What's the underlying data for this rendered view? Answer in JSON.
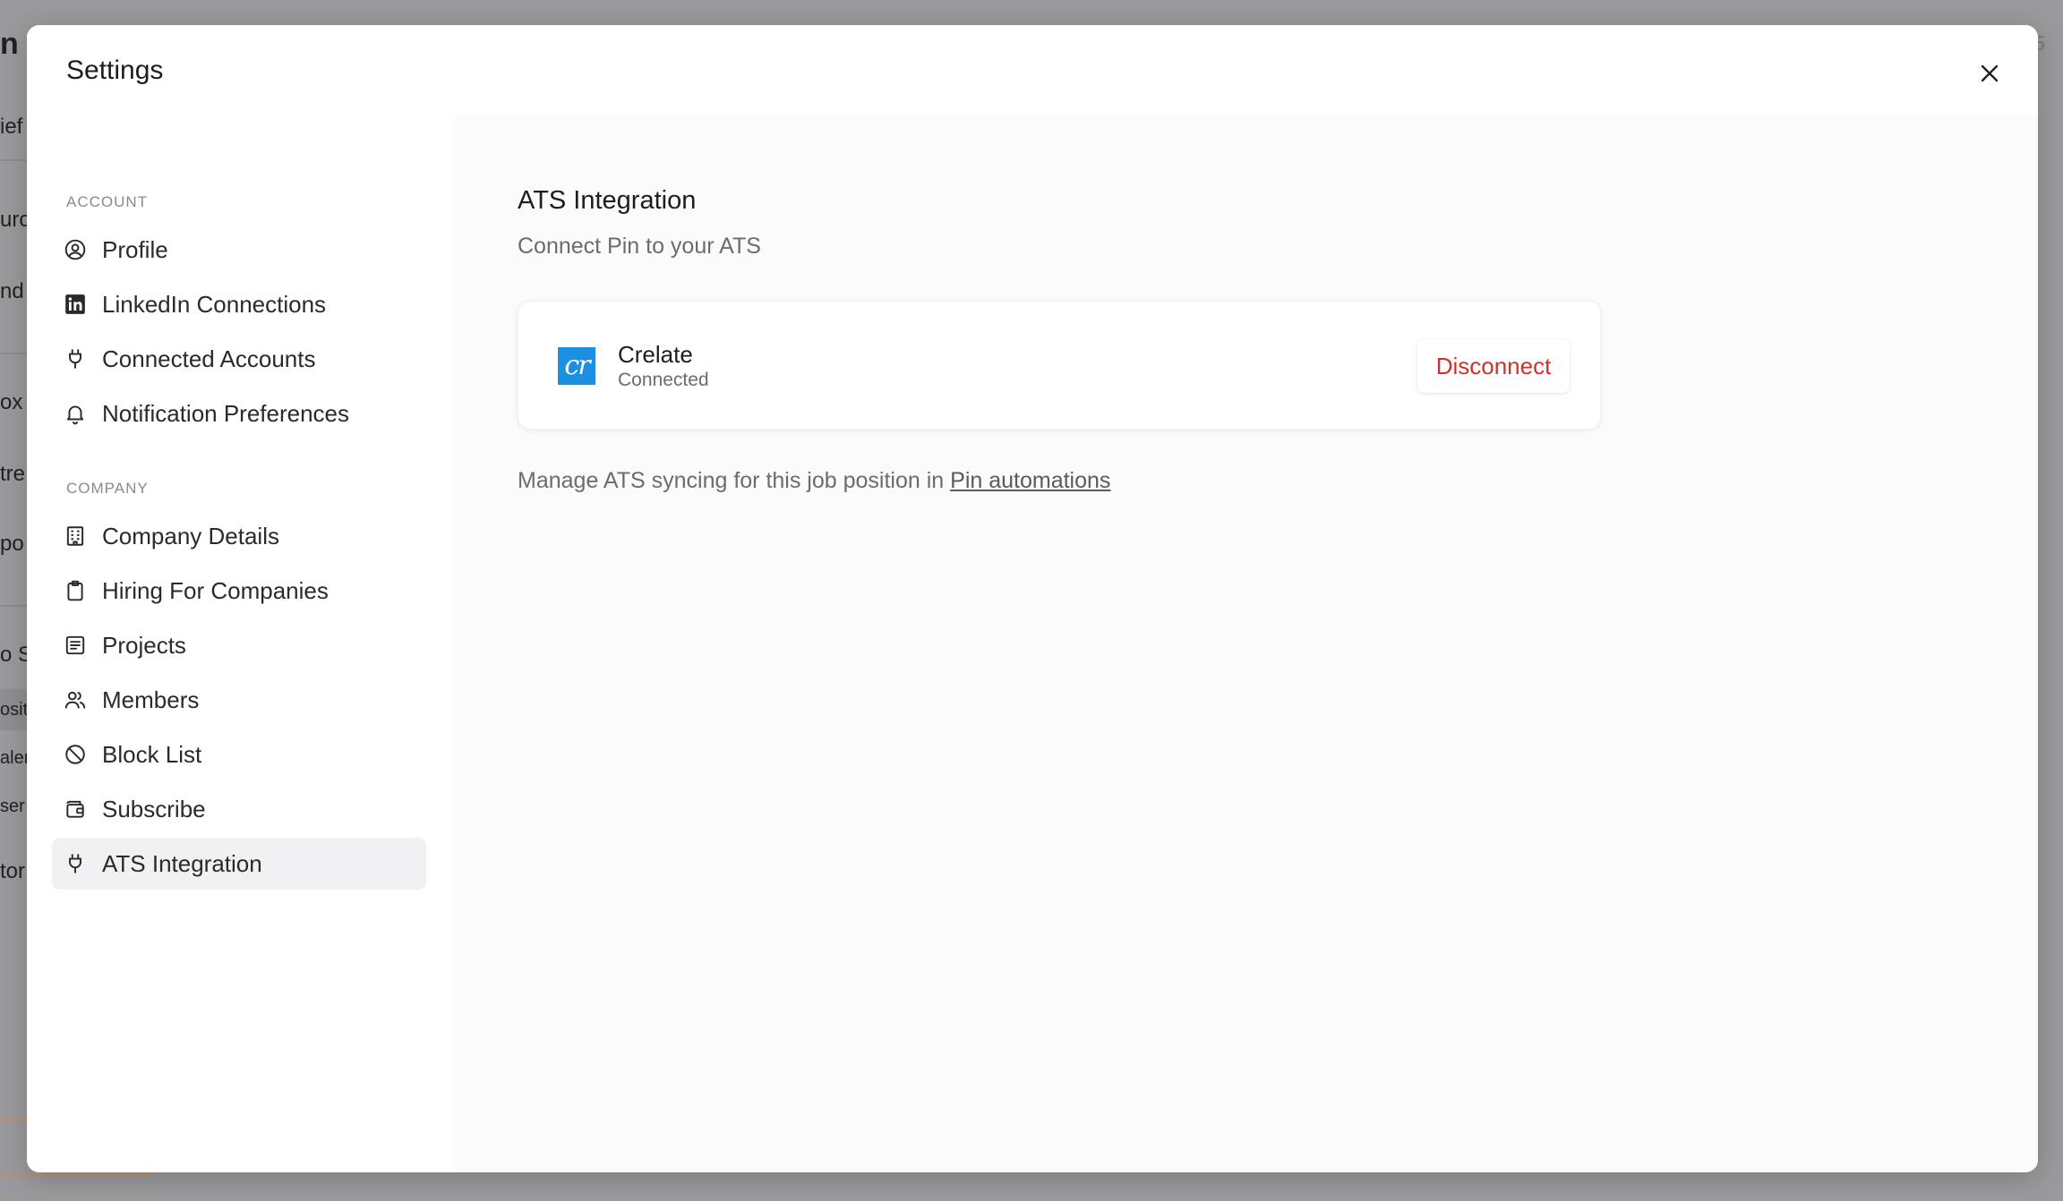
{
  "background": {
    "fragments": [
      "n",
      "ief",
      "urc",
      "nd",
      "ox",
      "tre",
      "po",
      "o S",
      "osit",
      "aler",
      "ser",
      "tor"
    ],
    "corner_number": "5"
  },
  "modal": {
    "title": "Settings",
    "close_icon": "close-icon"
  },
  "sidebar": {
    "account_label": "ACCOUNT",
    "company_label": "COMPANY",
    "account_items": [
      {
        "label": "Profile",
        "icon": "user-circle-icon"
      },
      {
        "label": "LinkedIn Connections",
        "icon": "linkedin-icon"
      },
      {
        "label": "Connected Accounts",
        "icon": "plug-icon"
      },
      {
        "label": "Notification Preferences",
        "icon": "bell-icon"
      }
    ],
    "company_items": [
      {
        "label": "Company Details",
        "icon": "building-icon"
      },
      {
        "label": "Hiring For Companies",
        "icon": "clipboard-icon"
      },
      {
        "label": "Projects",
        "icon": "list-icon"
      },
      {
        "label": "Members",
        "icon": "users-icon"
      },
      {
        "label": "Block List",
        "icon": "ban-icon"
      },
      {
        "label": "Subscribe",
        "icon": "wallet-icon"
      },
      {
        "label": "ATS Integration",
        "icon": "plug-icon"
      }
    ],
    "active_item": "ATS Integration"
  },
  "content": {
    "title": "ATS Integration",
    "subtitle": "Connect Pin to your ATS",
    "integration": {
      "logo_text": "cr",
      "name": "Crelate",
      "status": "Connected",
      "action_label": "Disconnect"
    },
    "manage_text": "Manage ATS syncing for this job position in",
    "manage_link": "Pin automations"
  },
  "colors": {
    "accent_danger": "#d0312d",
    "crelate_blue": "#1b8fe0",
    "overlay": "#9a9a9d"
  }
}
